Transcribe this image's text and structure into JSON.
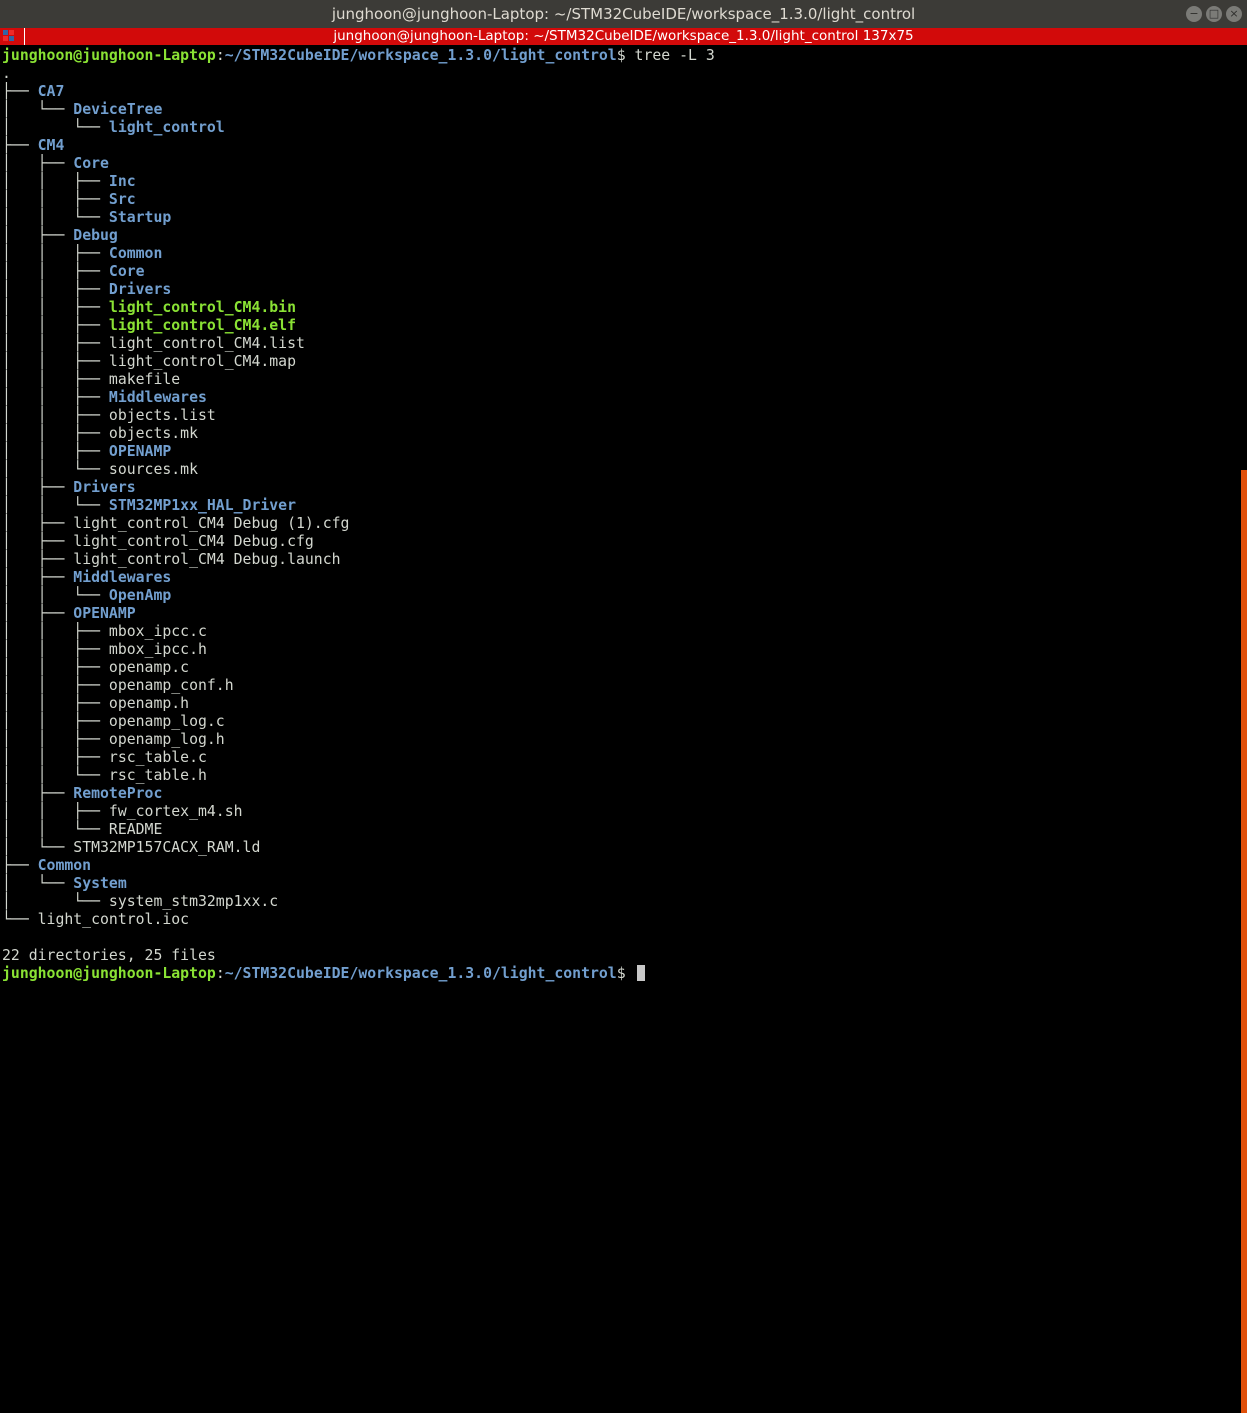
{
  "window": {
    "title": "junghoon@junghoon-Laptop: ~/STM32CubeIDE/workspace_1.3.0/light_control",
    "tab_title": "junghoon@junghoon-Laptop: ~/STM32CubeIDE/workspace_1.3.0/light_control 137x75",
    "minimize_glyph": "−",
    "maximize_glyph": "□",
    "close_glyph": "×"
  },
  "prompt": {
    "user": "junghoon@junghoon-Laptop",
    "sep": ":",
    "path": "~/STM32CubeIDE/workspace_1.3.0/light_control",
    "symbol": "$ ",
    "command": "tree -L 3"
  },
  "tree": [
    {
      "prefix": "",
      "name": ".",
      "type": "file"
    },
    {
      "prefix": "├── ",
      "name": "CA7",
      "type": "dir"
    },
    {
      "prefix": "│   └── ",
      "name": "DeviceTree",
      "type": "dir"
    },
    {
      "prefix": "│       └── ",
      "name": "light_control",
      "type": "dir"
    },
    {
      "prefix": "├── ",
      "name": "CM4",
      "type": "dir"
    },
    {
      "prefix": "│   ├── ",
      "name": "Core",
      "type": "dir"
    },
    {
      "prefix": "│   │   ├── ",
      "name": "Inc",
      "type": "dir"
    },
    {
      "prefix": "│   │   ├── ",
      "name": "Src",
      "type": "dir"
    },
    {
      "prefix": "│   │   └── ",
      "name": "Startup",
      "type": "dir"
    },
    {
      "prefix": "│   ├── ",
      "name": "Debug",
      "type": "dir"
    },
    {
      "prefix": "│   │   ├── ",
      "name": "Common",
      "type": "dir"
    },
    {
      "prefix": "│   │   ├── ",
      "name": "Core",
      "type": "dir"
    },
    {
      "prefix": "│   │   ├── ",
      "name": "Drivers",
      "type": "dir"
    },
    {
      "prefix": "│   │   ├── ",
      "name": "light_control_CM4.bin",
      "type": "exec"
    },
    {
      "prefix": "│   │   ├── ",
      "name": "light_control_CM4.elf",
      "type": "exec"
    },
    {
      "prefix": "│   │   ├── ",
      "name": "light_control_CM4.list",
      "type": "file"
    },
    {
      "prefix": "│   │   ├── ",
      "name": "light_control_CM4.map",
      "type": "file"
    },
    {
      "prefix": "│   │   ├── ",
      "name": "makefile",
      "type": "file"
    },
    {
      "prefix": "│   │   ├── ",
      "name": "Middlewares",
      "type": "dir"
    },
    {
      "prefix": "│   │   ├── ",
      "name": "objects.list",
      "type": "file"
    },
    {
      "prefix": "│   │   ├── ",
      "name": "objects.mk",
      "type": "file"
    },
    {
      "prefix": "│   │   ├── ",
      "name": "OPENAMP",
      "type": "dir"
    },
    {
      "prefix": "│   │   └── ",
      "name": "sources.mk",
      "type": "file"
    },
    {
      "prefix": "│   ├── ",
      "name": "Drivers",
      "type": "dir"
    },
    {
      "prefix": "│   │   └── ",
      "name": "STM32MP1xx_HAL_Driver",
      "type": "dir"
    },
    {
      "prefix": "│   ├── ",
      "name": "light_control_CM4 Debug (1).cfg",
      "type": "file"
    },
    {
      "prefix": "│   ├── ",
      "name": "light_control_CM4 Debug.cfg",
      "type": "file"
    },
    {
      "prefix": "│   ├── ",
      "name": "light_control_CM4 Debug.launch",
      "type": "file"
    },
    {
      "prefix": "│   ├── ",
      "name": "Middlewares",
      "type": "dir"
    },
    {
      "prefix": "│   │   └── ",
      "name": "OpenAmp",
      "type": "dir"
    },
    {
      "prefix": "│   ├── ",
      "name": "OPENAMP",
      "type": "dir"
    },
    {
      "prefix": "│   │   ├── ",
      "name": "mbox_ipcc.c",
      "type": "file"
    },
    {
      "prefix": "│   │   ├── ",
      "name": "mbox_ipcc.h",
      "type": "file"
    },
    {
      "prefix": "│   │   ├── ",
      "name": "openamp.c",
      "type": "file"
    },
    {
      "prefix": "│   │   ├── ",
      "name": "openamp_conf.h",
      "type": "file"
    },
    {
      "prefix": "│   │   ├── ",
      "name": "openamp.h",
      "type": "file"
    },
    {
      "prefix": "│   │   ├── ",
      "name": "openamp_log.c",
      "type": "file"
    },
    {
      "prefix": "│   │   ├── ",
      "name": "openamp_log.h",
      "type": "file"
    },
    {
      "prefix": "│   │   ├── ",
      "name": "rsc_table.c",
      "type": "file"
    },
    {
      "prefix": "│   │   └── ",
      "name": "rsc_table.h",
      "type": "file"
    },
    {
      "prefix": "│   ├── ",
      "name": "RemoteProc",
      "type": "dir"
    },
    {
      "prefix": "│   │   ├── ",
      "name": "fw_cortex_m4.sh",
      "type": "file"
    },
    {
      "prefix": "│   │   └── ",
      "name": "README",
      "type": "file"
    },
    {
      "prefix": "│   └── ",
      "name": "STM32MP157CACX_RAM.ld",
      "type": "file"
    },
    {
      "prefix": "├── ",
      "name": "Common",
      "type": "dir"
    },
    {
      "prefix": "│   └── ",
      "name": "System",
      "type": "dir"
    },
    {
      "prefix": "│       └── ",
      "name": "system_stm32mp1xx.c",
      "type": "file"
    },
    {
      "prefix": "└── ",
      "name": "light_control.ioc",
      "type": "file"
    }
  ],
  "summary": "22 directories, 25 files",
  "colors": {
    "titlebar": "#3c3b37",
    "tabbar": "#d20a0a",
    "user": "#8ae234",
    "directory": "#729fcf",
    "executable": "#8ae234",
    "text": "#d3d7cf",
    "scrollbar": "#e0500a"
  }
}
